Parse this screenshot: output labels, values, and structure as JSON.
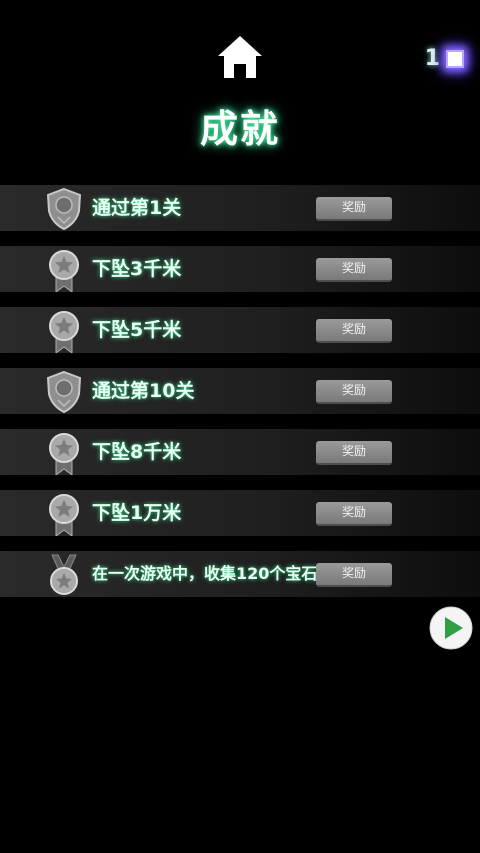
{
  "header": {
    "title": "成就",
    "gem_count": "1"
  },
  "achievements": [
    {
      "label": "通过第1关",
      "reward_label": "奖励",
      "medal_icon": "shield-medal"
    },
    {
      "label": "下坠3千米",
      "reward_label": "奖励",
      "medal_icon": "ribbon-medal"
    },
    {
      "label": "下坠5千米",
      "reward_label": "奖励",
      "medal_icon": "ribbon-medal"
    },
    {
      "label": "通过第10关",
      "reward_label": "奖励",
      "medal_icon": "shield-medal"
    },
    {
      "label": "下坠8千米",
      "reward_label": "奖励",
      "medal_icon": "ribbon-medal"
    },
    {
      "label": "下坠1万米",
      "reward_label": "奖励",
      "medal_icon": "ribbon-medal"
    },
    {
      "label": "在一次游戏中，收集120个宝石",
      "reward_label": "奖励",
      "medal_icon": "neck-medal"
    }
  ],
  "colors": {
    "background": "#000000",
    "title_glow": "#4fffb0",
    "gem": "#8a6bff",
    "button": "#8a8a8a",
    "play": "#2ea043"
  }
}
